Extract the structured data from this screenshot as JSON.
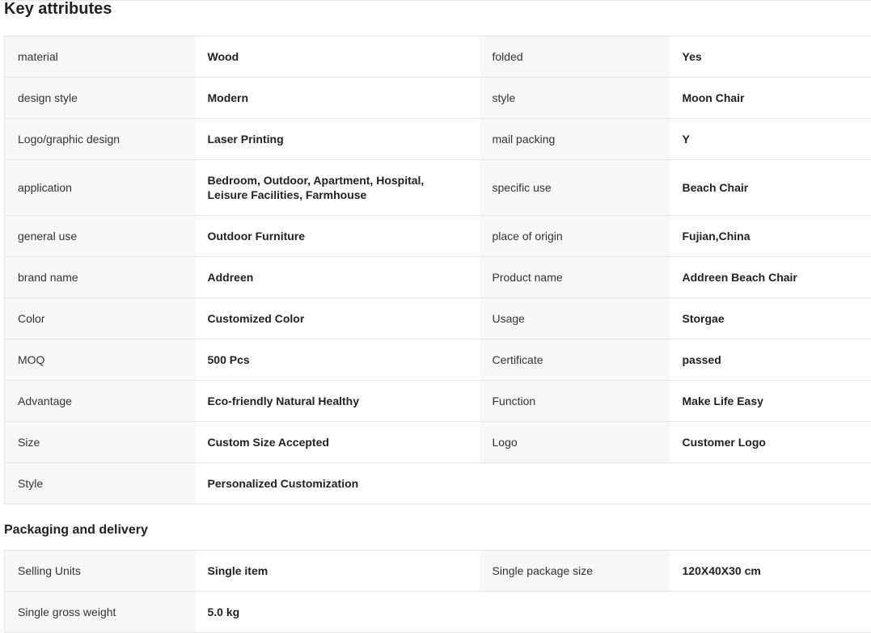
{
  "key_attributes": {
    "title": "Key attributes",
    "rows": [
      {
        "l1": "material",
        "v1": "Wood",
        "l2": "folded",
        "v2": "Yes"
      },
      {
        "l1": "design style",
        "v1": "Modern",
        "l2": "style",
        "v2": "Moon Chair"
      },
      {
        "l1": "Logo/graphic design",
        "v1": "Laser Printing",
        "l2": "mail packing",
        "v2": "Y"
      },
      {
        "l1": "application",
        "v1": "Bedroom, Outdoor, Apartment, Hospital, Leisure Facilities, Farmhouse",
        "l2": "specific use",
        "v2": "Beach Chair"
      },
      {
        "l1": "general use",
        "v1": "Outdoor Furniture",
        "l2": "place of origin",
        "v2": "Fujian,China"
      },
      {
        "l1": "brand name",
        "v1": "Addreen",
        "l2": "Product name",
        "v2": "Addreen Beach Chair"
      },
      {
        "l1": "Color",
        "v1": "Customized Color",
        "l2": "Usage",
        "v2": "Storgae"
      },
      {
        "l1": "MOQ",
        "v1": "500 Pcs",
        "l2": "Certificate",
        "v2": "passed"
      },
      {
        "l1": "Advantage",
        "v1": "Eco-friendly Natural Healthy",
        "l2": "Function",
        "v2": "Make Life Easy"
      },
      {
        "l1": "Size",
        "v1": "Custom Size Accepted",
        "l2": "Logo",
        "v2": "Customer Logo"
      },
      {
        "l1": "Style",
        "v1": "Personalized Customization"
      }
    ]
  },
  "packaging": {
    "title": "Packaging and delivery",
    "rows": [
      {
        "l1": "Selling Units",
        "v1": "Single item",
        "l2": "Single package size",
        "v2": "120X40X30 cm"
      },
      {
        "l1": "Single gross weight",
        "v1": "5.0 kg"
      }
    ]
  }
}
